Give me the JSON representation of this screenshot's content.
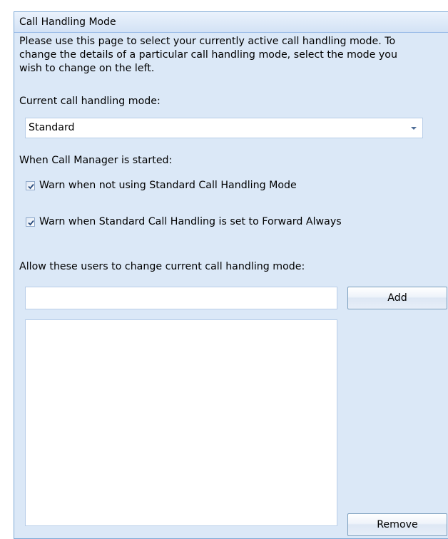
{
  "panel": {
    "title": "Call Handling Mode",
    "description_lines": [
      "Please use this page to select your currently active call handling mode. To",
      "change the details of a particular call handling mode, select the mode you",
      "wish to change on the left."
    ]
  },
  "current_mode": {
    "label": "Current call handling mode:",
    "selected": "Standard"
  },
  "startup": {
    "label": "When Call Manager is started:",
    "options": [
      {
        "label": "Warn when not using Standard Call Handling Mode",
        "checked": true
      },
      {
        "label": "Warn when Standard Call Handling is set to Forward Always",
        "checked": true
      }
    ]
  },
  "users": {
    "label": "Allow these users to change current call handling mode:",
    "input_value": "",
    "add_label": "Add",
    "remove_label": "Remove",
    "list": []
  }
}
